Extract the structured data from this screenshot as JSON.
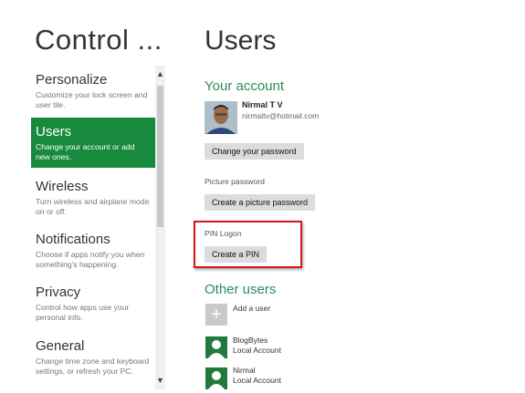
{
  "nav": {
    "title": "Control ...",
    "items": [
      {
        "label": "Personalize",
        "desc": "Customize your lock screen and user tile."
      },
      {
        "label": "Users",
        "desc": "Change your account or add new ones."
      },
      {
        "label": "Wireless",
        "desc": "Turn wireless and airplane mode on or off."
      },
      {
        "label": "Notifications",
        "desc": "Choose if apps notify you when something's happening."
      },
      {
        "label": "Privacy",
        "desc": "Control how apps use your personal info."
      },
      {
        "label": "General",
        "desc": "Change time zone and keyboard settings, or refresh your PC."
      }
    ],
    "selected_index": 1
  },
  "main": {
    "title": "Users",
    "your_account": {
      "heading": "Your account",
      "name": "Nirmal T V",
      "email": "nirmaltv@hotmail.com",
      "change_password_label": "Change your password"
    },
    "picture_password": {
      "label": "Picture password",
      "button_label": "Create a picture password"
    },
    "pin_logon": {
      "label": "PIN Logon",
      "button_label": "Create a PIN"
    },
    "other_users": {
      "heading": "Other users",
      "add_label": "Add a user",
      "users": [
        {
          "name": "BlogBytes",
          "type": "Local Account"
        },
        {
          "name": "Nirmal",
          "type": "Local Account"
        }
      ]
    }
  },
  "colors": {
    "accent_green": "#178a3d",
    "heading_green": "#2e8b57",
    "highlight_red": "#d4161b"
  }
}
